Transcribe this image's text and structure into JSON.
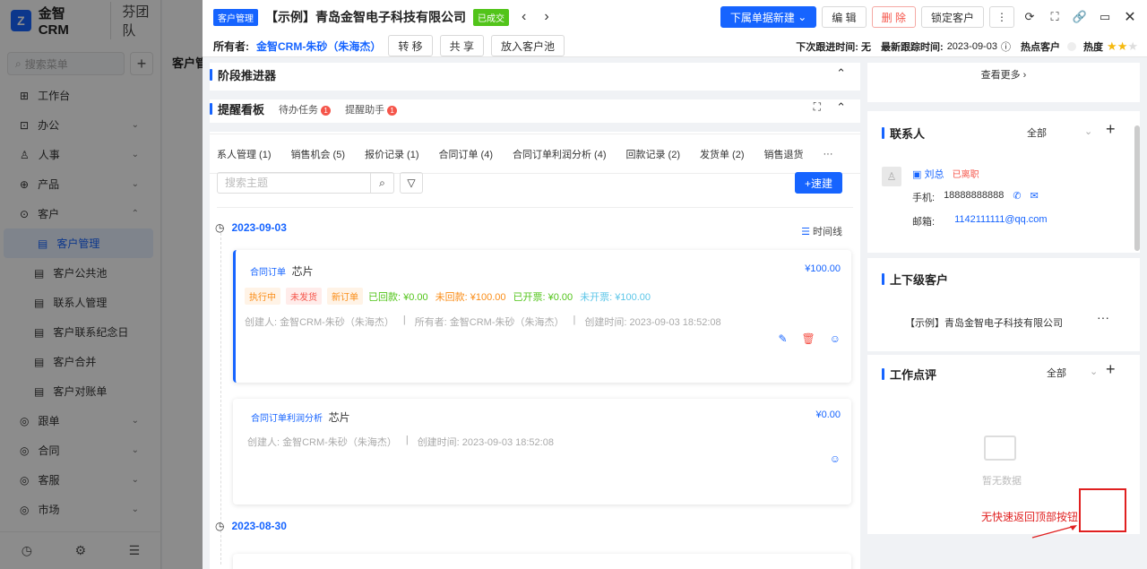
{
  "app": {
    "logo_text": "金智CRM",
    "team": "芬团队",
    "search_placeholder": "搜索菜单",
    "bg_title": "客户管"
  },
  "menu": [
    {
      "label": "工作台",
      "icon": "⊞",
      "name": "workbench"
    },
    {
      "label": "办公",
      "icon": "⊡",
      "name": "office",
      "chev": "⌄"
    },
    {
      "label": "人事",
      "icon": "♙",
      "name": "hr",
      "chev": "⌄"
    },
    {
      "label": "产品",
      "icon": "⊕",
      "name": "product",
      "chev": "⌄"
    },
    {
      "label": "客户",
      "icon": "⊙",
      "name": "customer",
      "chev": "⌃"
    }
  ],
  "submenu": [
    {
      "label": "客户管理",
      "active": true
    },
    {
      "label": "客户公共池"
    },
    {
      "label": "联系人管理"
    },
    {
      "label": "客户联系纪念日"
    },
    {
      "label": "客户合并"
    },
    {
      "label": "客户对账单"
    }
  ],
  "menu2": [
    {
      "label": "跟单"
    },
    {
      "label": "合同"
    },
    {
      "label": "客服"
    },
    {
      "label": "市场"
    }
  ],
  "header": {
    "module_tag": "客户管理",
    "company": "【示例】青岛金智电子科技有限公司",
    "status": "已成交",
    "btn_new": "下属单据新建",
    "btn_edit": "编 辑",
    "btn_delete": "删 除",
    "btn_lock": "锁定客户",
    "owner_label": "所有者:",
    "owner": "金智CRM-朱砂（朱海杰）",
    "btn_transfer": "转 移",
    "btn_share": "共 享",
    "btn_pool": "放入客户池",
    "next_follow": "下次跟进时间: 无",
    "last_follow_label": "最新跟踪时间:",
    "last_follow": "2023-09-03",
    "hot": "热点客户",
    "heat": "热度",
    "heat_level": 2
  },
  "stage": {
    "title": "阶段推进器"
  },
  "board": {
    "title": "提醒看板",
    "tab1": "待办任务",
    "tab2": "提醒助手",
    "badge": "1"
  },
  "tabs": [
    "系人管理 (1)",
    "销售机会 (5)",
    "报价记录 (1)",
    "合同订单 (4)",
    "合同订单利润分析 (4)",
    "回款记录 (2)",
    "发货单 (2)",
    "销售退货",
    "···"
  ],
  "search": {
    "placeholder": "搜索主题",
    "quick_btn": "+速建",
    "timeline": "时间线"
  },
  "timeline": [
    {
      "date": "2023-09-03"
    },
    {
      "date": "2023-08-30"
    }
  ],
  "card1": {
    "type": "合同订单",
    "title": "芯片",
    "amount": "¥100.00",
    "tags": [
      {
        "t": "执行中",
        "c": "#fa8c16",
        "bg": "#fff3e6"
      },
      {
        "t": "未发货",
        "c": "#f5554a",
        "bg": "#ffecea"
      },
      {
        "t": "新订单",
        "c": "#fa8c16",
        "bg": "#fff3e6"
      }
    ],
    "stats": [
      {
        "t": "已回款: ¥0.00",
        "c": "#52c41a"
      },
      {
        "t": "未回款: ¥100.00",
        "c": "#fa8c16"
      },
      {
        "t": "已开票: ¥0.00",
        "c": "#52c41a"
      },
      {
        "t": "未开票: ¥100.00",
        "c": "#5cc6e8"
      }
    ],
    "meta1": "创建人: 金智CRM-朱砂（朱海杰）",
    "meta2": "所有者: 金智CRM-朱砂（朱海杰）",
    "meta3": "创建时间: 2023-09-03 18:52:08"
  },
  "card2": {
    "type": "合同订单利润分析",
    "title": "芯片",
    "amount": "¥0.00",
    "meta1": "创建人: 金智CRM-朱砂（朱海杰）",
    "meta3": "创建时间: 2023-09-03 18:52:08"
  },
  "right": {
    "more": "查看更多",
    "contacts": {
      "title": "联系人",
      "filter": "全部",
      "name": "刘总",
      "status": "已离职",
      "phone_label": "手机:",
      "phone": "18888888888",
      "email_label": "邮箱:",
      "email": "1142111111@qq.com"
    },
    "related": {
      "title": "上下级客户",
      "company": "【示例】青岛金智电子科技有限公司"
    },
    "review": {
      "title": "工作点评",
      "filter": "全部",
      "empty": "暂无数据"
    }
  },
  "annotation": "无快速返回顶部按钮"
}
